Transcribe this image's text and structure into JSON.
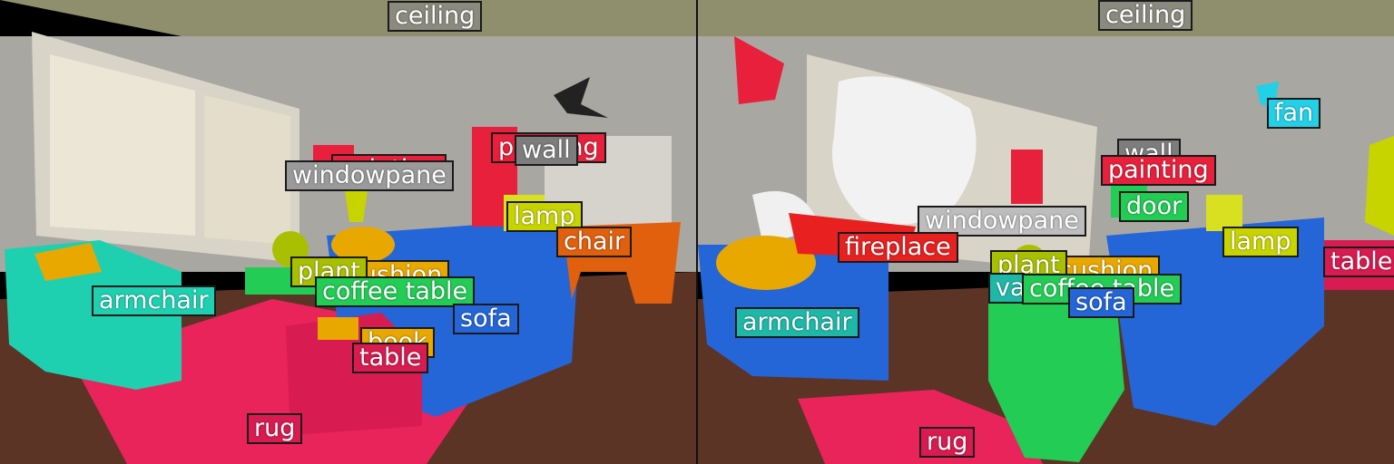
{
  "panels": [
    {
      "labels": [
        {
          "text": "ceiling",
          "color": "#8a8a7e"
        },
        {
          "text": "wall",
          "color": "#7d7d7d"
        },
        {
          "text": "painting",
          "color": "#e8203c"
        },
        {
          "text": "windowpane",
          "color": "#9a9a9a"
        },
        {
          "text": "lamp",
          "color": "#c8d400"
        },
        {
          "text": "chair",
          "color": "#e0600e"
        },
        {
          "text": "plant",
          "color": "#a8c000"
        },
        {
          "text": "cushion",
          "color": "#e8a800"
        },
        {
          "text": "coffee table",
          "color": "#22cc55"
        },
        {
          "text": "sofa",
          "color": "#2466d8"
        },
        {
          "text": "armchair",
          "color": "#1fd0b0"
        },
        {
          "text": "book",
          "color": "#e8a800"
        },
        {
          "text": "table",
          "color": "#d81b50"
        },
        {
          "text": "rug",
          "color": "#d81b50"
        }
      ]
    },
    {
      "labels": [
        {
          "text": "ceiling",
          "color": "#8a8a7e"
        },
        {
          "text": "fan",
          "color": "#22d0e8"
        },
        {
          "text": "wall",
          "color": "#7d7d7d"
        },
        {
          "text": "painting",
          "color": "#e8203c"
        },
        {
          "text": "door",
          "color": "#22cc55"
        },
        {
          "text": "windowpane",
          "color": "#bdbdbd"
        },
        {
          "text": "lamp",
          "color": "#c8d400"
        },
        {
          "text": "table",
          "color": "#d81b50"
        },
        {
          "text": "fireplace",
          "color": "#e82020"
        },
        {
          "text": "plant",
          "color": "#a8c000"
        },
        {
          "text": "cushion",
          "color": "#e8a800"
        },
        {
          "text": "vase",
          "color": "#1fb8a8"
        },
        {
          "text": "coffee table",
          "color": "#22cc55"
        },
        {
          "text": "sofa",
          "color": "#2466d8"
        },
        {
          "text": "armchair",
          "color": "#1fb8a8"
        },
        {
          "text": "rug",
          "color": "#d81b50"
        }
      ]
    }
  ]
}
